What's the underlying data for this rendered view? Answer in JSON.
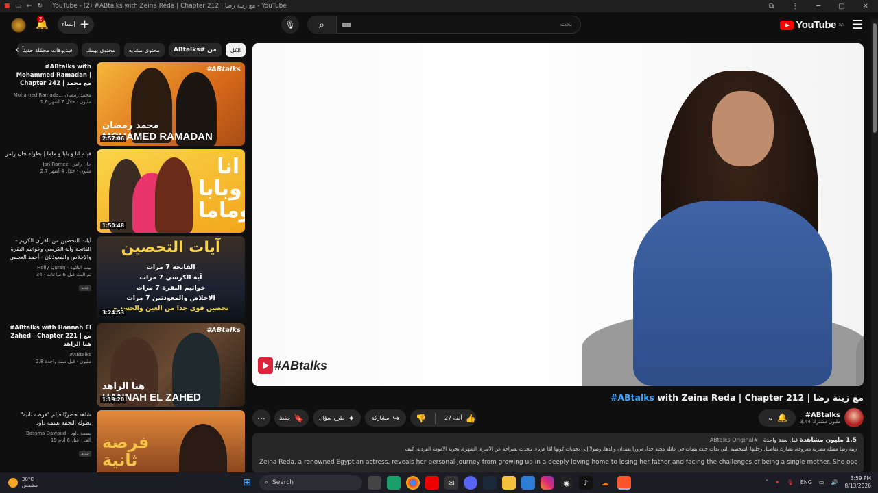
{
  "browser": {
    "title": "YouTube - (2) #ABtalks with Zeina Reda | Chapter 212 | مع زينة رضا - YouTube"
  },
  "masthead": {
    "logo_text": "YouTube",
    "region": "SA",
    "search_placeholder": "بحث",
    "create_label": "إنشاء",
    "notifications_count": "2"
  },
  "chips": [
    {
      "label": "الكل",
      "active": true
    },
    {
      "label": "من #ABtalks",
      "active": false,
      "bold": true
    },
    {
      "label": "محتوى مشابه",
      "active": false
    },
    {
      "label": "محتوى يهمك",
      "active": false
    },
    {
      "label": "فيديوهات محمّلة حديثاً",
      "active": false
    }
  ],
  "recommendations": [
    {
      "title": "#ABtalks with Mohammed Ramadan | Chapter 242 | مع محمد رمضان",
      "channel": "Mohamed Ramada... محمد رمضان",
      "views": "1.6 مليون · خلال 7 أشهر",
      "duration": "2:57:06",
      "thumb_tag": "#ABtalks",
      "thumb_cap_ar": "محمد رمضان",
      "thumb_cap_en": "MOHAMED RAMADAN"
    },
    {
      "title": "فيلم انا و بابا و ماما | بطولة جان رامز",
      "channel": "Jan Ramez - جان رامز",
      "views": "2.7 مليون · خلال 4 أشهر",
      "duration": "1:50:48",
      "thumb_cap_ar": "انا وبابا وماما"
    },
    {
      "title": "آيات التحصين من القرآن الكريم - الفاتحة وآية الكرسي وخواتيم البقرة والإخلاص والمعوذتان - أحمد العجمي",
      "channel": "Holly Quran - بيت التلاوة",
      "views": "34 · تم البث قبل 6 ساعات",
      "badge": "جديد",
      "duration": "3:24:53",
      "thumb_cap_ar": "آيات التحصين",
      "thumb_lines": [
        "الفاتحة 7 مرات",
        "آية الكرسي 7 مرات",
        "خواتيم البقرة 7 مرات",
        "الاخلاص والمعوذتين 7 مرات",
        "تحصين قوي جدا من العين والحسد و"
      ]
    },
    {
      "title": "#ABtalks with Hannah El Zahed | Chapter 221 | مع هنا الزاهد",
      "channel": "#ABtalks",
      "views": "2.8 مليون · قبل سنة واحدة",
      "duration": "1:19:20",
      "thumb_tag": "#ABtalks",
      "thumb_cap_ar": "هنا الزاهد",
      "thumb_cap_en": "HANNAH EL ZAHED"
    },
    {
      "title": "شاهد حصريًا فيلم \"فرصة ثانية\" بطولة النجمة بسمة داود",
      "channel": "Bassma Dawoud - بسمة داود",
      "views": "19 ألف · قبل 6 أيام",
      "badge": "جديد",
      "thumb_cap_ar": "فرصة ثانية"
    }
  ],
  "video": {
    "title_hash": "#ABtalks",
    "title_rest": " with Zeina Reda | Chapter 212 | مع زينة رضا",
    "watermark": "#ABtalks",
    "channel_name": "#ABtalks",
    "subscribers": "3.44 مليون مشترك",
    "likes": "27 ألف",
    "share_label": "مشاركة",
    "ask_label": "طرح سؤال",
    "save_label": "حفظ",
    "description": {
      "views": "1.5 مليون مشاهدة",
      "age": "قبل سنة واحدة",
      "tag": "#ABtalks Original",
      "ar_line": "زينة رضا ممثلة مصرية معروفة، تشارك تفاصيل رحلتها الشخصية التي بدأت حيث نشأت في عائلة محبة جداً، مروراً بفقدان والدها، وصولاً إلى تحديات كونها أمًا عزباء. تتحدث بصراحة عن الأسرة، الشهرة، تجربة الأمومة الفردية، كيف",
      "en_line": "Zeina Reda, a renowned Egyptian actress, reveals her personal journey from growing up in a deeply loving home to losing her father and facing the challenges of being a single mother. She opens up about h"
    }
  },
  "taskbar": {
    "temp": "30°C",
    "condition": "مشمس",
    "search_label": "Search",
    "lang": "ENG",
    "time": "3:59 PM",
    "date": "8/13/2026"
  }
}
